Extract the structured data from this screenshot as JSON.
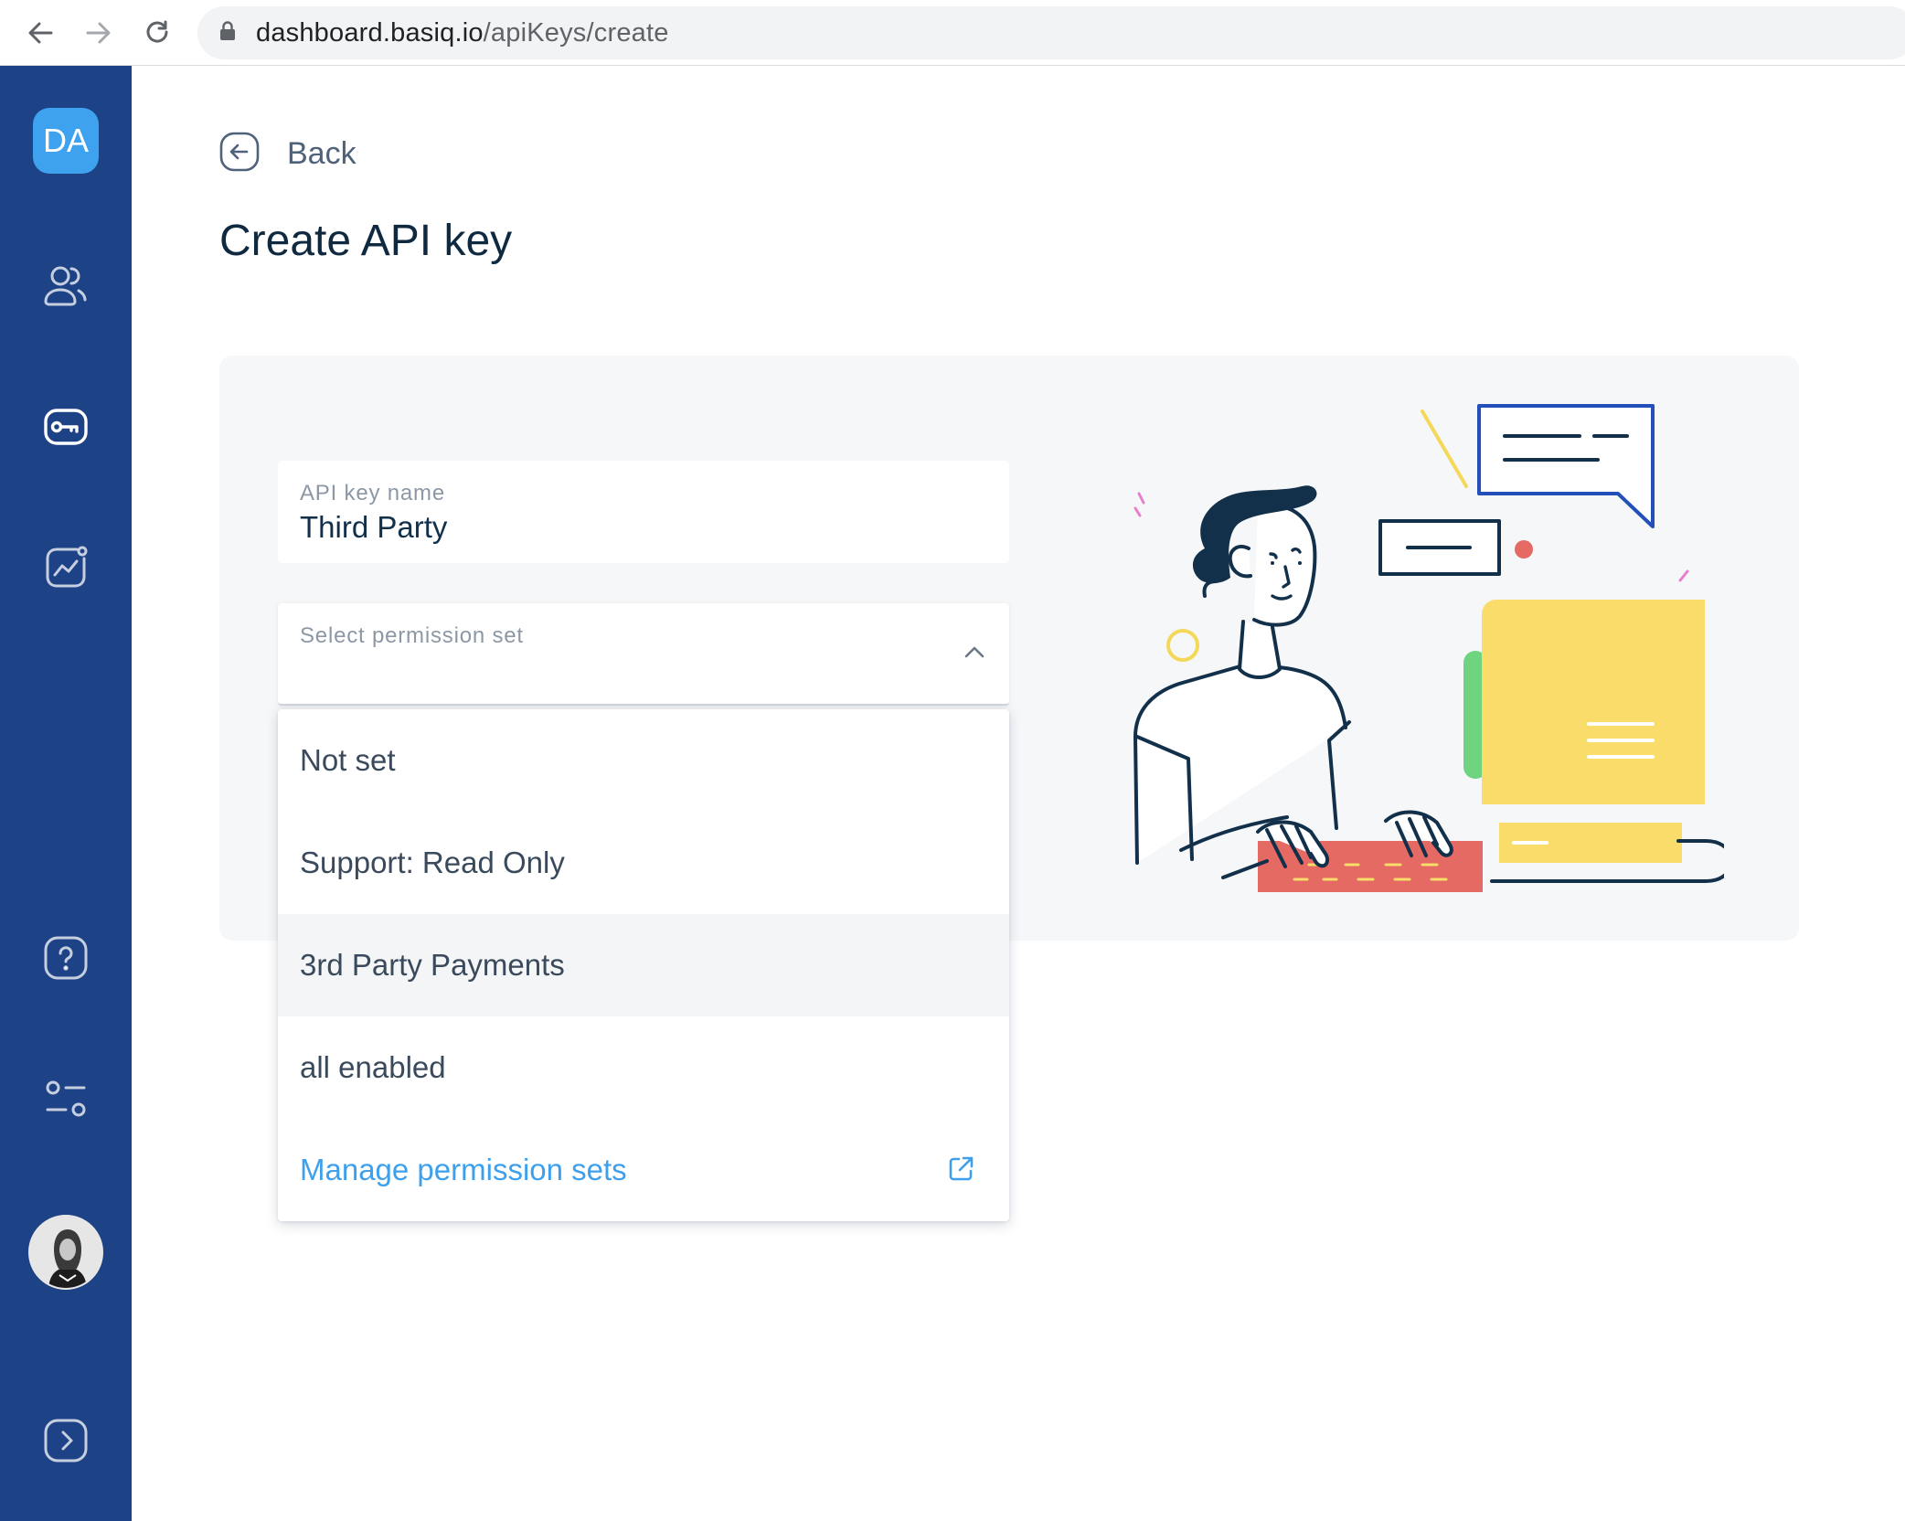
{
  "browser": {
    "url_host": "dashboard.basiq.io",
    "url_path": "/apiKeys/create"
  },
  "sidebar": {
    "badge": "DA",
    "items": [
      {
        "name": "users",
        "icon": "users-icon"
      },
      {
        "name": "api-keys",
        "icon": "key-icon"
      },
      {
        "name": "analytics",
        "icon": "chart-icon"
      },
      {
        "name": "help",
        "icon": "help-icon"
      },
      {
        "name": "settings",
        "icon": "sliders-icon"
      },
      {
        "name": "expand",
        "icon": "chevron-right-icon"
      }
    ]
  },
  "main": {
    "back_label": "Back",
    "title": "Create API key",
    "name_field": {
      "label": "API key name",
      "value": "Third Party"
    },
    "permission_field": {
      "label": "Select permission set",
      "value": ""
    },
    "options": [
      {
        "label": "Not set",
        "highlighted": false
      },
      {
        "label": "Support: Read Only",
        "highlighted": false
      },
      {
        "label": "3rd Party Payments",
        "highlighted": true
      },
      {
        "label": "all enabled",
        "highlighted": false
      }
    ],
    "manage_link": "Manage permission sets"
  },
  "colors": {
    "sidebar": "#1d4285",
    "accent": "#3ea2ef",
    "link": "#3ea0ec",
    "title": "#0f2a40"
  }
}
